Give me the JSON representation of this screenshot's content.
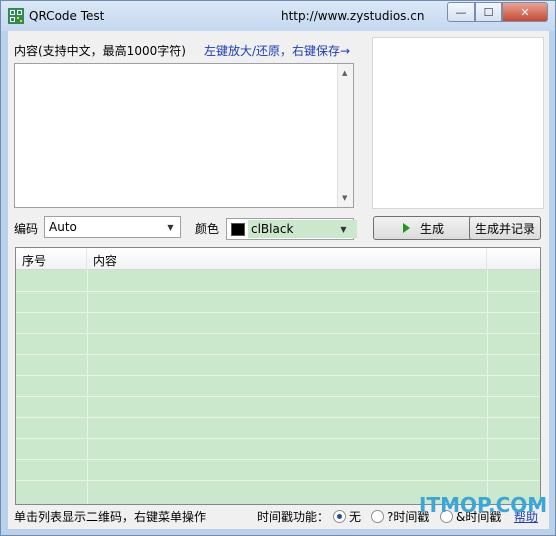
{
  "window": {
    "title": "QRCode Test",
    "url": "http://www.zystudios.cn",
    "controls": {
      "minimize": "—",
      "maximize": "☐",
      "close": "✕"
    }
  },
  "content_label": "内容(支持中文，最高1000字符)",
  "zoom_hint": "左键放大/还原，右键保存→",
  "memo": {
    "value": ""
  },
  "encoding": {
    "label": "编码",
    "selected": "Auto"
  },
  "color": {
    "label": "颜色",
    "selected": "clBlack",
    "swatch": "#000000"
  },
  "buttons": {
    "generate": "生成",
    "generate_record": "生成并记录"
  },
  "list": {
    "columns": [
      "序号",
      "内容"
    ],
    "rows": []
  },
  "status": {
    "hint": "单击列表显示二维码，右键菜单操作",
    "timestamp_label": "时间戳功能：",
    "options": [
      "无",
      "?时间戳",
      "&时间戳"
    ],
    "selected_option": "无",
    "link": "帮助"
  },
  "watermark": "ITMOP.COM",
  "colors": {
    "accent_link": "#1c3db5",
    "list_bg": "#cce8cc"
  }
}
